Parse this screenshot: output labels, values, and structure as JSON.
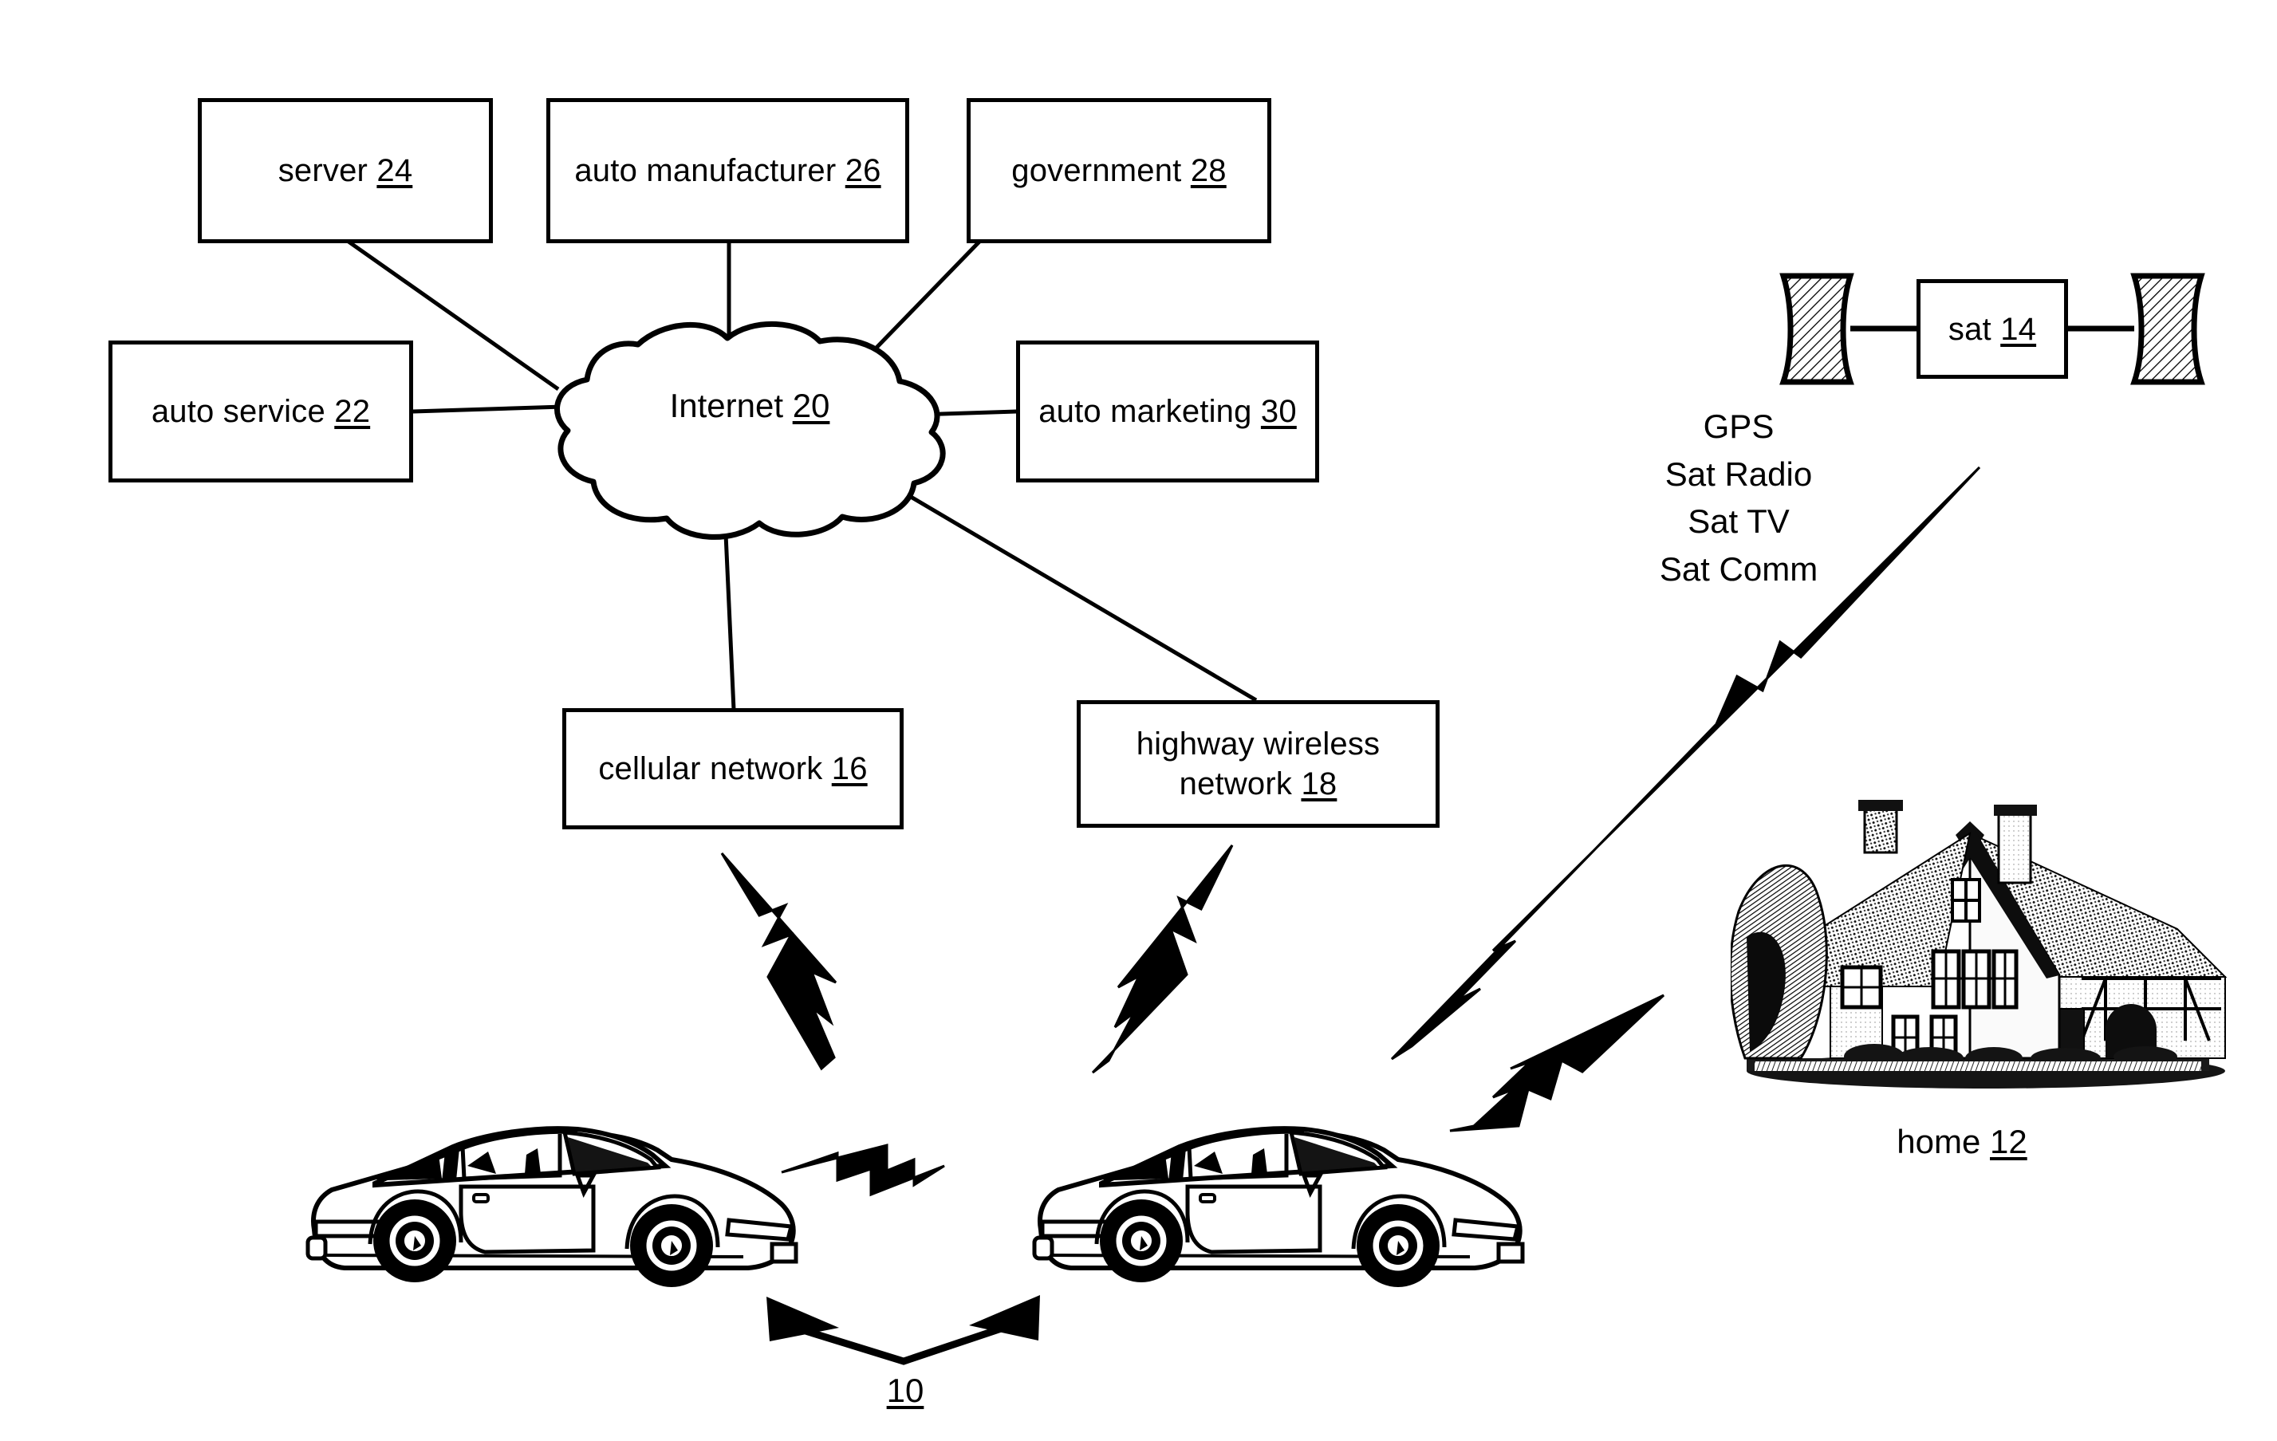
{
  "figure": {
    "title": "Vehicle communication network diagram",
    "ink_color": "#000000",
    "background_color": "#ffffff"
  },
  "nodes": {
    "server": {
      "label": "server",
      "ref": "24"
    },
    "auto_manufacturer": {
      "label": "auto manufacturer",
      "ref": "26"
    },
    "government": {
      "label": "government",
      "ref": "28"
    },
    "auto_service": {
      "label": "auto service",
      "ref": "22"
    },
    "auto_marketing": {
      "label": "auto marketing",
      "ref": "30"
    },
    "internet": {
      "label": "Internet",
      "ref": "20"
    },
    "cellular_network": {
      "label": "cellular network",
      "ref": "16"
    },
    "highway_wireless_network": {
      "label_line1": "highway wireless",
      "label_line2": "network",
      "ref": "18"
    },
    "satellite": {
      "label": "sat",
      "ref": "14"
    },
    "home": {
      "label": "home",
      "ref": "12"
    },
    "vehicles": {
      "ref": "10"
    }
  },
  "satellite_services": {
    "items": [
      "GPS",
      "Sat Radio",
      "Sat TV",
      "Sat Comm"
    ]
  },
  "icons": {
    "cloud": "cloud-icon",
    "satellite_panel_left": "solar-panel-icon",
    "satellite_panel_right": "solar-panel-icon",
    "house": "house-icon",
    "car_left": "car-icon",
    "car_right": "car-icon",
    "lightning_cellular": "lightning-bolt-icon",
    "lightning_highway": "lightning-bolt-icon",
    "lightning_satellite": "lightning-bolt-icon",
    "lightning_home": "lightning-bolt-icon",
    "lightning_v2v": "lightning-bolt-icon",
    "arrow_v2v": "double-arrow-icon"
  }
}
